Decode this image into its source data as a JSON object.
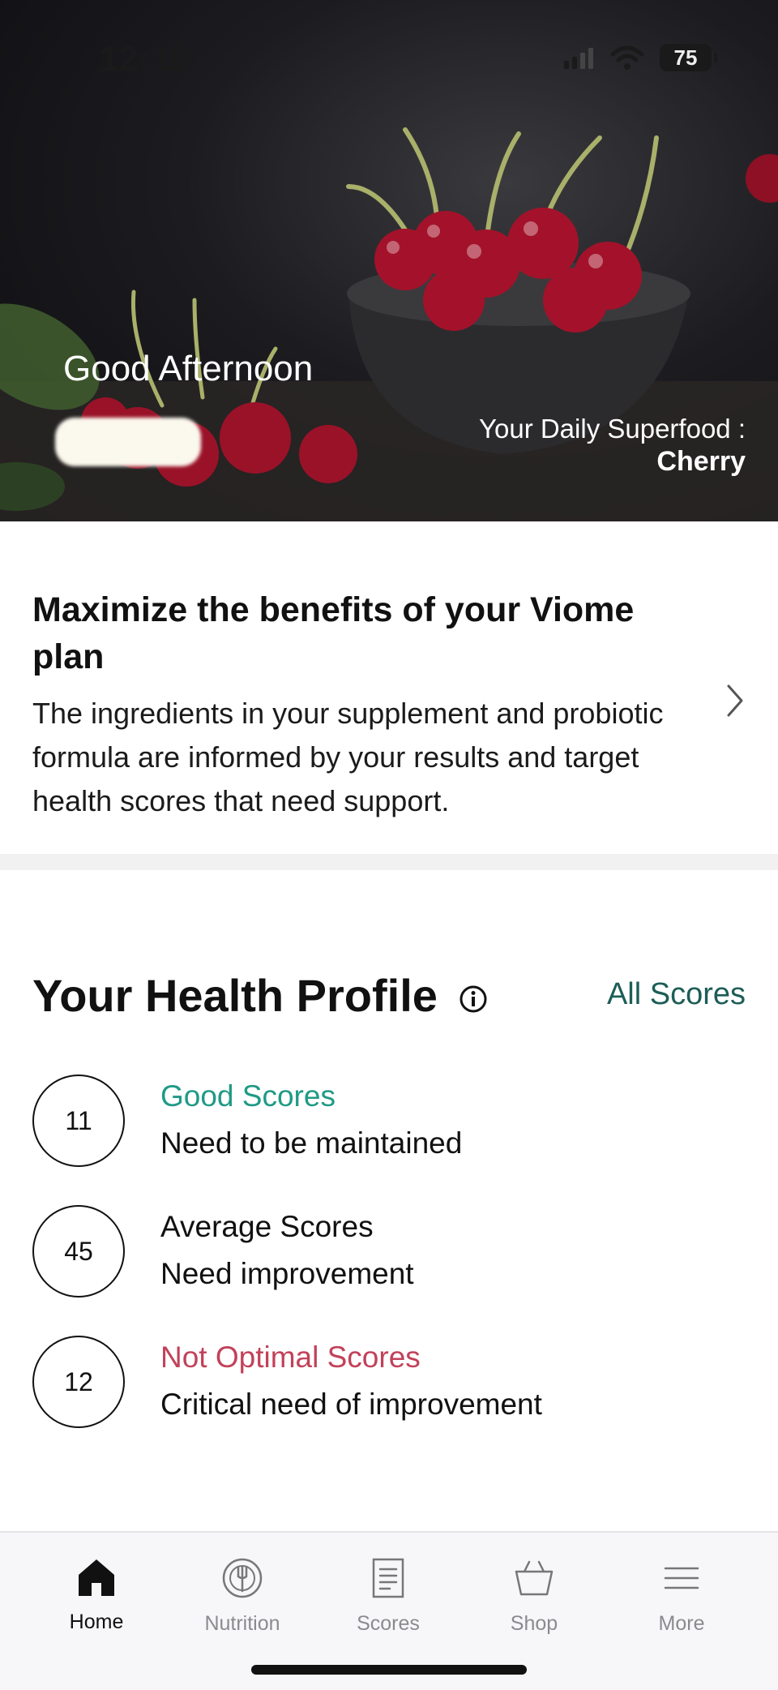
{
  "status_bar": {
    "time": "12:19",
    "battery": "75"
  },
  "hero": {
    "greeting": "Good Afternoon",
    "superfood_label": "Your Daily Superfood :",
    "superfood_name": "Cherry"
  },
  "promo": {
    "title": "Maximize the benefits of your Viome plan",
    "body": "The ingredients in your supplement and probiotic formula are informed by your results and target health scores that need support."
  },
  "health_profile": {
    "title": "Your Health Profile",
    "all_scores_link": "All Scores",
    "rows": [
      {
        "count": "11",
        "label": "Good Scores",
        "sublabel": "Need to be maintained",
        "color": "#1f9a85"
      },
      {
        "count": "45",
        "label": "Average Scores",
        "sublabel": "Need improvement",
        "color": "#111111"
      },
      {
        "count": "12",
        "label": "Not Optimal Scores",
        "sublabel": "Critical need of improvement",
        "color": "#c2415a"
      }
    ]
  },
  "tabbar": {
    "tabs": [
      {
        "label": "Home",
        "icon": "home-icon",
        "active": true
      },
      {
        "label": "Nutrition",
        "icon": "plate-fork-icon",
        "active": false
      },
      {
        "label": "Scores",
        "icon": "document-icon",
        "active": false
      },
      {
        "label": "Shop",
        "icon": "basket-icon",
        "active": false
      },
      {
        "label": "More",
        "icon": "menu-icon",
        "active": false
      }
    ]
  }
}
